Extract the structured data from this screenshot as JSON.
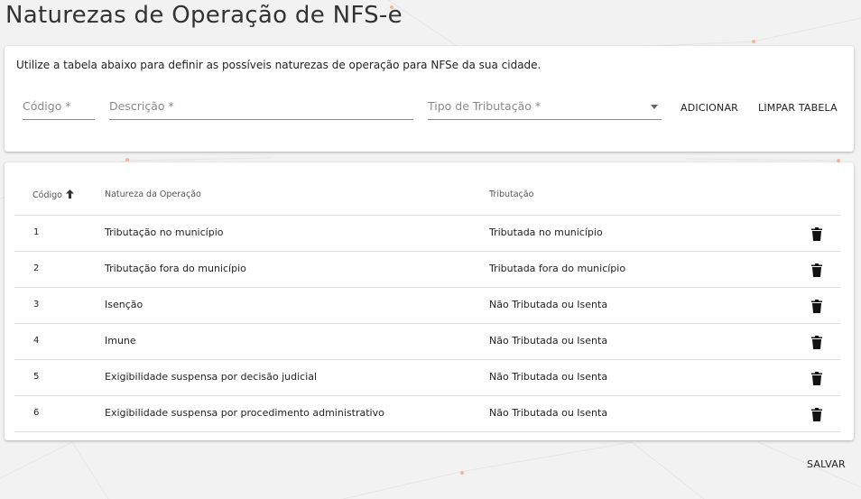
{
  "page": {
    "title": "Naturezas de Operação de NFS-e"
  },
  "form": {
    "instructions": "Utilize a tabela abaixo para definir as possíveis naturezas de operação para NFSe da sua cidade.",
    "codigo_label": "Código *",
    "descricao_label": "Descrição *",
    "tipo_label": "Tipo de Tributação *",
    "adicionar_label": "ADICIONAR",
    "limpar_label": "LIMPAR TABELA"
  },
  "table": {
    "headers": {
      "codigo": "Código",
      "natureza": "Natureza da Operação",
      "tributacao": "Tributação"
    },
    "sort": "ascending",
    "rows": [
      {
        "codigo": "1",
        "natureza": "Tributação no município",
        "tributacao": "Tributada no município"
      },
      {
        "codigo": "2",
        "natureza": "Tributação fora do município",
        "tributacao": "Tributada fora do município"
      },
      {
        "codigo": "3",
        "natureza": "Isenção",
        "tributacao": "Não Tributada ou Isenta"
      },
      {
        "codigo": "4",
        "natureza": "Imune",
        "tributacao": "Não Tributada ou Isenta"
      },
      {
        "codigo": "5",
        "natureza": "Exigibilidade suspensa por decisão judicial",
        "tributacao": "Não Tributada ou Isenta"
      },
      {
        "codigo": "6",
        "natureza": "Exigibilidade suspensa por procedimento administrativo",
        "tributacao": "Não Tributada ou Isenta"
      }
    ],
    "row_action_icon": "trash-icon"
  },
  "footer": {
    "salvar_label": "SALVAR"
  },
  "colors": {
    "background": "#f2f2f2",
    "card": "#ffffff",
    "accent_dots": "#f5b59a"
  }
}
